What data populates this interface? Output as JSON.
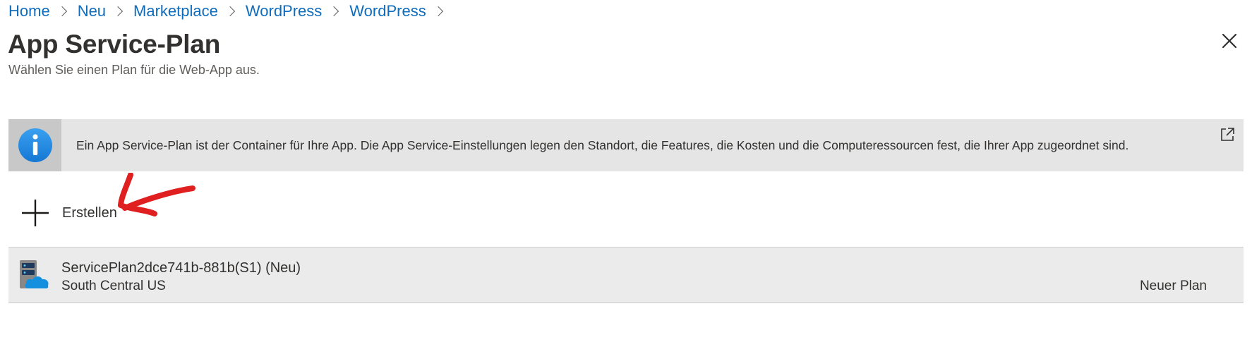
{
  "breadcrumb": [
    {
      "label": "Home"
    },
    {
      "label": "Neu"
    },
    {
      "label": "Marketplace"
    },
    {
      "label": "WordPress"
    },
    {
      "label": "WordPress"
    }
  ],
  "header": {
    "title": "App Service-Plan",
    "subtitle": "Wählen Sie einen Plan für die Web-App aus."
  },
  "info": {
    "text": "Ein App Service-Plan ist der Container für Ihre App. Die App Service-Einstellungen legen den Standort, die Features, die Kosten und die Computeressourcen fest, die Ihrer App zugeordnet sind."
  },
  "actions": {
    "create_label": "Erstellen"
  },
  "plans": [
    {
      "name": "ServicePlan2dce741b-881b(S1) (Neu)",
      "region": "South Central US",
      "tag": "Neuer Plan"
    }
  ],
  "colors": {
    "link": "#0f6cbd",
    "info_bg": "#e5e5e5",
    "info_icon_bg": "#c8c8c8",
    "row_bg": "#ebebeb",
    "annotation": "#e02020"
  }
}
